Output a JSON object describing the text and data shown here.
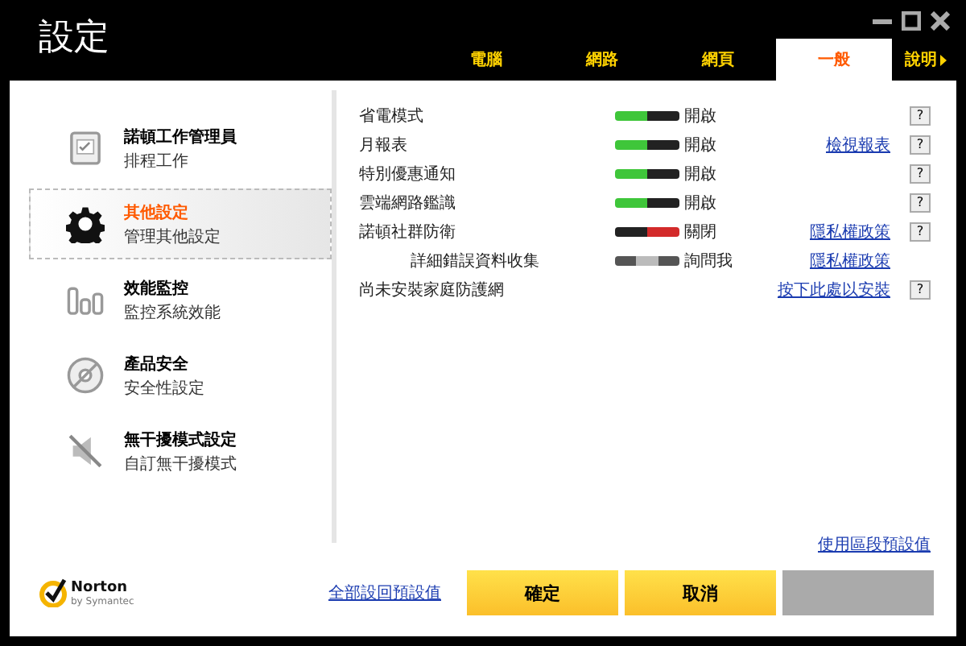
{
  "window": {
    "title": "設定"
  },
  "tabs": [
    {
      "label": "電腦",
      "selected": false
    },
    {
      "label": "網路",
      "selected": false
    },
    {
      "label": "網頁",
      "selected": false
    },
    {
      "label": "一般",
      "selected": true
    }
  ],
  "help_menu": {
    "label": "說明"
  },
  "sidebar": {
    "items": [
      {
        "kind": "tasks",
        "title": "諾頓工作管理員",
        "subtitle": "排程工作",
        "selected": false
      },
      {
        "kind": "gear",
        "title": "其他設定",
        "subtitle": "管理其他設定",
        "selected": true
      },
      {
        "kind": "bars",
        "title": "效能監控",
        "subtitle": "監控系統效能",
        "selected": false
      },
      {
        "kind": "disc",
        "title": "產品安全",
        "subtitle": "安全性設定",
        "selected": false
      },
      {
        "kind": "mute",
        "title": "無干擾模式設定",
        "subtitle": "自訂無干擾模式",
        "selected": false
      }
    ]
  },
  "settings": [
    {
      "label": "省電模式",
      "kind": "on",
      "status": "開啟",
      "help": "?"
    },
    {
      "label": "月報表",
      "kind": "on",
      "status": "開啟",
      "link": "檢視報表",
      "help": "?"
    },
    {
      "label": "特別優惠通知",
      "kind": "on",
      "status": "開啟",
      "help": "?"
    },
    {
      "label": "雲端網路鑑識",
      "kind": "on",
      "status": "開啟",
      "help": "?"
    },
    {
      "label": "諾頓社群防衛",
      "kind": "off",
      "status": "關閉",
      "link": "隱私權政策",
      "help": "?",
      "children": [
        {
          "label": "詳細錯誤資料收集",
          "kind": "ask",
          "status": "詢問我",
          "link": "隱私權政策"
        }
      ]
    },
    {
      "label": "尚未安裝家庭防護網",
      "kind": "link",
      "link": "按下此處以安裝",
      "help": "?"
    }
  ],
  "section_defaults_link": "使用區段預設值",
  "footer": {
    "logo": {
      "name": "Norton",
      "tagline": "by Symantec"
    },
    "reset_link": "全部設回預設值",
    "buttons": [
      {
        "label": "確定",
        "enabled": true
      },
      {
        "label": "取消",
        "enabled": true
      },
      {
        "enabled": false
      }
    ]
  }
}
